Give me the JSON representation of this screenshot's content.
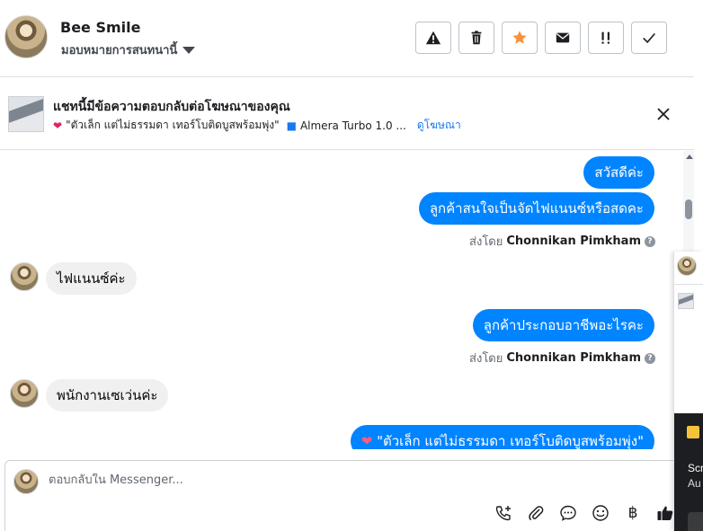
{
  "header": {
    "contact_name": "Bee Smile",
    "assign_label": "มอบหมายการสนทนานี้",
    "actions": [
      "warning-icon",
      "trash-icon",
      "star-icon",
      "envelope-icon",
      "urgent-icon",
      "check-icon"
    ],
    "star_color": "#f7923a"
  },
  "ad": {
    "title": "แชทนี้มีข้อความตอบกลับต่อโฆษณาของคุณ",
    "ad_text": "\"ตัวเล็ก แต่ไม่ธรรมดา เทอร์โบติดบูสพร้อมพุ่ง\"",
    "car_text": "Almera Turbo 1.0 ...",
    "view_ad": "ดูโฆษณา"
  },
  "messages": {
    "m1": "สวัสดีค่ะ",
    "m2": "ลูกค้าสนใจเป็นจัดไฟแนนซ์หรือสดคะ",
    "sent_by_label": "ส่งโดย",
    "sender": "Chonnikan Pimkham",
    "m3": "ไฟแนนซ์ค่ะ",
    "m4": "ลูกค้าประกอบอาชีพอะไรคะ",
    "m5": "พนักงานเซเว่นค่ะ",
    "m6": "\"ตัวเล็ก แต่ไม่ธรรมดา เทอร์โบติดบูสพร้อมพุ่ง\""
  },
  "composer": {
    "placeholder": "ตอบกลับใน Messenger...",
    "baht": "฿"
  },
  "side_panel": {
    "text1": "Scr",
    "text2": "Au"
  },
  "colors": {
    "outgoing_bubble": "#0084ff",
    "incoming_bubble": "#f0f0f0",
    "link": "#1877f2"
  }
}
